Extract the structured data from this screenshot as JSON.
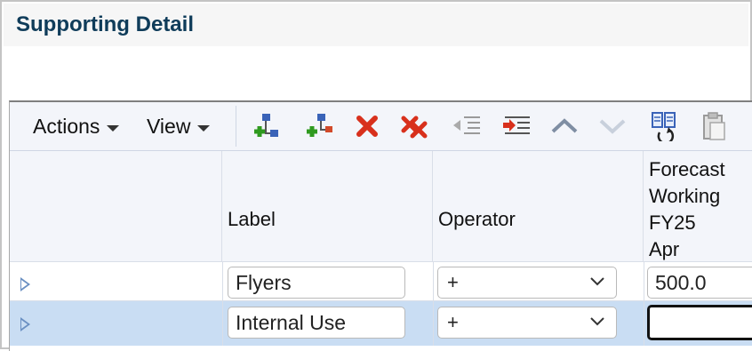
{
  "page": {
    "title": "Supporting Detail"
  },
  "toolbar": {
    "actions_label": "Actions",
    "view_label": "View",
    "icons": [
      "add-sibling-icon",
      "add-child-icon",
      "delete-icon",
      "delete-all-icon",
      "promote-icon",
      "demote-icon",
      "move-up-icon",
      "move-down-icon",
      "duplicate-icon",
      "paste-icon"
    ]
  },
  "table": {
    "columns": {
      "label": "Label",
      "operator": "Operator",
      "forecast": [
        "Forecast",
        "Working",
        "FY25",
        "Apr"
      ]
    },
    "rows": [
      {
        "label": "Flyers",
        "operator": "+",
        "value": "500.0"
      },
      {
        "label": "Internal Use",
        "operator": "+",
        "value": ""
      }
    ]
  },
  "colors": {
    "title": "#0f3c5a",
    "selected_row": "#c9ddf3",
    "header_bg": "#f3f5fa"
  }
}
